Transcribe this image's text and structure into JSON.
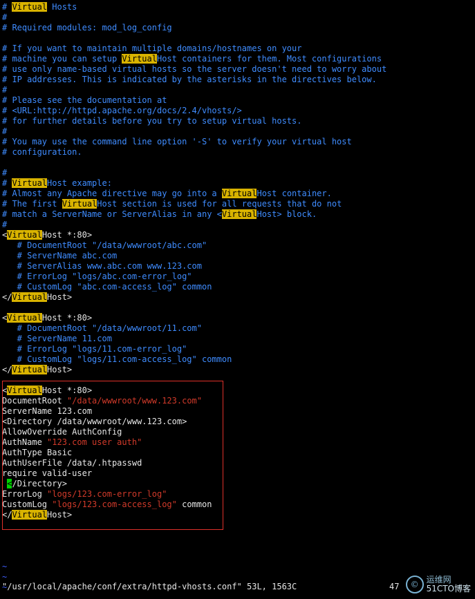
{
  "colors": {
    "comment": "#3f8cff",
    "text": "#e6e6e6",
    "string": "#d23a2a",
    "highlight": "#d9b300",
    "cursor": "#00d000",
    "tilde": "#3f5fff",
    "box": "#e0302a"
  },
  "lines": [
    {
      "c": "comment",
      "parts": [
        {
          "t": "# "
        },
        {
          "t": "Virtual",
          "hl": true
        },
        {
          "t": " Hosts"
        }
      ]
    },
    {
      "c": "comment",
      "parts": [
        {
          "t": "#"
        }
      ]
    },
    {
      "c": "comment",
      "parts": [
        {
          "t": "# Required modules: mod_log_config"
        }
      ]
    },
    {
      "c": "comment",
      "parts": [
        {
          "t": ""
        }
      ]
    },
    {
      "c": "comment",
      "parts": [
        {
          "t": "# If you want to maintain multiple domains/hostnames on your"
        }
      ]
    },
    {
      "c": "comment",
      "parts": [
        {
          "t": "# machine you can setup "
        },
        {
          "t": "Virtual",
          "hl": true
        },
        {
          "t": "Host containers for them. Most configurations"
        }
      ]
    },
    {
      "c": "comment",
      "parts": [
        {
          "t": "# use only name-based virtual hosts so the server doesn't need to worry about"
        }
      ]
    },
    {
      "c": "comment",
      "parts": [
        {
          "t": "# IP addresses. This is indicated by the asterisks in the directives below."
        }
      ]
    },
    {
      "c": "comment",
      "parts": [
        {
          "t": "#"
        }
      ]
    },
    {
      "c": "comment",
      "parts": [
        {
          "t": "# Please see the documentation at"
        }
      ]
    },
    {
      "c": "comment",
      "parts": [
        {
          "t": "# <URL:http://httpd.apache.org/docs/2.4/vhosts/>"
        }
      ]
    },
    {
      "c": "comment",
      "parts": [
        {
          "t": "# for further details before you try to setup virtual hosts."
        }
      ]
    },
    {
      "c": "comment",
      "parts": [
        {
          "t": "#"
        }
      ]
    },
    {
      "c": "comment",
      "parts": [
        {
          "t": "# You may use the command line option '-S' to verify your virtual host"
        }
      ]
    },
    {
      "c": "comment",
      "parts": [
        {
          "t": "# configuration."
        }
      ]
    },
    {
      "c": "comment",
      "parts": [
        {
          "t": ""
        }
      ]
    },
    {
      "c": "comment",
      "parts": [
        {
          "t": "#"
        }
      ]
    },
    {
      "c": "comment",
      "parts": [
        {
          "t": "# "
        },
        {
          "t": "Virtual",
          "hl": true
        },
        {
          "t": "Host example:"
        }
      ]
    },
    {
      "c": "comment",
      "parts": [
        {
          "t": "# Almost any Apache directive may go into a "
        },
        {
          "t": "Virtual",
          "hl": true
        },
        {
          "t": "Host container."
        }
      ]
    },
    {
      "c": "comment",
      "parts": [
        {
          "t": "# The first "
        },
        {
          "t": "Virtual",
          "hl": true
        },
        {
          "t": "Host section is used for all requests that do not"
        }
      ]
    },
    {
      "c": "comment",
      "parts": [
        {
          "t": "# match a ServerName or ServerAlias in any <"
        },
        {
          "t": "Virtual",
          "hl": true
        },
        {
          "t": "Host> block."
        }
      ]
    },
    {
      "c": "comment",
      "parts": [
        {
          "t": "#"
        }
      ]
    },
    {
      "c": "text",
      "parts": [
        {
          "t": "<"
        },
        {
          "t": "Virtual",
          "hl": true
        },
        {
          "t": "Host *:80>"
        }
      ]
    },
    {
      "c": "comment",
      "parts": [
        {
          "t": "   # DocumentRoot \"/data/wwwroot/abc.com\""
        }
      ]
    },
    {
      "c": "comment",
      "parts": [
        {
          "t": "   # ServerName abc.com"
        }
      ]
    },
    {
      "c": "comment",
      "parts": [
        {
          "t": "   # ServerAlias www.abc.com www.123.com"
        }
      ]
    },
    {
      "c": "comment",
      "parts": [
        {
          "t": "   # ErrorLog \"logs/abc.com-error_log\""
        }
      ]
    },
    {
      "c": "comment",
      "parts": [
        {
          "t": "   # CustomLog \"abc.com-access_log\" common"
        }
      ]
    },
    {
      "c": "text",
      "parts": [
        {
          "t": "</"
        },
        {
          "t": "Virtual",
          "hl": true
        },
        {
          "t": "Host>"
        }
      ]
    },
    {
      "c": "text",
      "parts": [
        {
          "t": ""
        }
      ]
    },
    {
      "c": "text",
      "parts": [
        {
          "t": "<"
        },
        {
          "t": "Virtual",
          "hl": true
        },
        {
          "t": "Host *:80>"
        }
      ]
    },
    {
      "c": "comment",
      "parts": [
        {
          "t": "   # DocumentRoot \"/data/wwwroot/11.com\""
        }
      ]
    },
    {
      "c": "comment",
      "parts": [
        {
          "t": "   # ServerName 11.com"
        }
      ]
    },
    {
      "c": "comment",
      "parts": [
        {
          "t": "   # ErrorLog \"logs/11.com-error_log\""
        }
      ]
    },
    {
      "c": "comment",
      "parts": [
        {
          "t": "   # CustomLog \"logs/11.com-access_log\" common"
        }
      ]
    },
    {
      "c": "text",
      "parts": [
        {
          "t": "</"
        },
        {
          "t": "Virtual",
          "hl": true
        },
        {
          "t": "Host>"
        }
      ]
    },
    {
      "c": "text",
      "parts": [
        {
          "t": ""
        }
      ]
    },
    {
      "c": "text",
      "parts": [
        {
          "t": "<"
        },
        {
          "t": "Virtual",
          "hl": true
        },
        {
          "t": "Host *:80>"
        }
      ]
    },
    {
      "c": "text",
      "parts": [
        {
          "t": "DocumentRoot "
        },
        {
          "t": "\"/data/wwwroot/www.123.com\"",
          "c": "string"
        }
      ]
    },
    {
      "c": "text",
      "parts": [
        {
          "t": "ServerName 123.com"
        }
      ]
    },
    {
      "c": "text",
      "parts": [
        {
          "t": "<Directory /data/wwwroot/www.123.com>"
        }
      ]
    },
    {
      "c": "text",
      "parts": [
        {
          "t": "AllowOverride AuthConfig"
        }
      ]
    },
    {
      "c": "text",
      "parts": [
        {
          "t": "AuthName "
        },
        {
          "t": "\"123.com user auth\"",
          "c": "string"
        }
      ]
    },
    {
      "c": "text",
      "parts": [
        {
          "t": "AuthType Basic"
        }
      ]
    },
    {
      "c": "text",
      "parts": [
        {
          "t": "AuthUserFile /data/.htpasswd"
        }
      ]
    },
    {
      "c": "text",
      "parts": [
        {
          "t": "require valid-user"
        }
      ]
    },
    {
      "c": "text",
      "parts": [
        {
          "t": " "
        },
        {
          "t": "<",
          "cursor": true
        },
        {
          "t": "/Directory>"
        }
      ]
    },
    {
      "c": "text",
      "parts": [
        {
          "t": "ErrorLog "
        },
        {
          "t": "\"logs/123.com-error_log\"",
          "c": "string"
        }
      ]
    },
    {
      "c": "text",
      "parts": [
        {
          "t": "CustomLog "
        },
        {
          "t": "\"logs/123.com-access_log\"",
          "c": "string"
        },
        {
          "t": " common"
        }
      ]
    },
    {
      "c": "text",
      "parts": [
        {
          "t": "</"
        },
        {
          "t": "Virtual",
          "hl": true
        },
        {
          "t": "Host>"
        }
      ]
    },
    {
      "c": "text",
      "parts": [
        {
          "t": ""
        }
      ]
    },
    {
      "c": "text",
      "parts": [
        {
          "t": ""
        }
      ]
    },
    {
      "c": "text",
      "parts": [
        {
          "t": ""
        }
      ]
    },
    {
      "c": "text",
      "parts": [
        {
          "t": ""
        }
      ]
    },
    {
      "c": "tilde",
      "parts": [
        {
          "t": "~"
        }
      ]
    },
    {
      "c": "tilde",
      "parts": [
        {
          "t": "~"
        }
      ]
    },
    {
      "c": "tilde",
      "parts": [
        {
          "t": "~"
        }
      ]
    }
  ],
  "status": {
    "file": "\"/usr/local/apache/conf/extra/httpd-vhosts.conf\" 53L, 1563C",
    "position": "47"
  },
  "watermark": {
    "logo_glyph": "©",
    "top": "运维网",
    "bottom": "51CTO博客"
  }
}
